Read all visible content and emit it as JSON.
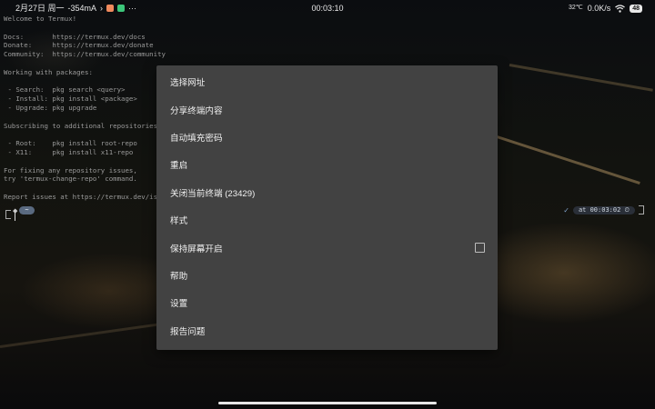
{
  "status_bar": {
    "date": "2月27日 周一",
    "current": "-354mA",
    "arrow": "›",
    "more": "···",
    "time": "00:03:10",
    "temperature": "32℃",
    "net_speed": "0.0K/s",
    "battery": "48"
  },
  "terminal": {
    "lines": [
      "Welcome to Termux!",
      "",
      "Docs:       https://termux.dev/docs",
      "Donate:     https://termux.dev/donate",
      "Community:  https://termux.dev/community",
      "",
      "Working with packages:",
      "",
      " - Search:  pkg search <query>",
      " - Install: pkg install <package>",
      " - Upgrade: pkg upgrade",
      "",
      "Subscribing to additional repositories:",
      "",
      " - Root:    pkg install root-repo",
      " - X11:     pkg install x11-repo",
      "",
      "For fixing any repository issues,",
      "try 'termux-change-repo' command.",
      "",
      "Report issues at https://termux.dev/issues"
    ],
    "prompt_left_symbol": "◆",
    "prompt_left_dir": "~",
    "prompt_right_check": "✓",
    "prompt_right_time": "at 00:03:02"
  },
  "menu": {
    "items": [
      {
        "label": "选择网址"
      },
      {
        "label": "分享终端内容"
      },
      {
        "label": "自动填充密码"
      },
      {
        "label": "重启"
      },
      {
        "label": "关闭当前终端 (23429)"
      },
      {
        "label": "样式"
      },
      {
        "label": "保持屏幕开启",
        "checkbox": true,
        "checked": false
      },
      {
        "label": "帮助"
      },
      {
        "label": "设置"
      },
      {
        "label": "报告问题"
      }
    ]
  },
  "colors": {
    "menu_background": "#424242",
    "menu_text": "#f0f0f0",
    "prompt_pill": "#5a6a80"
  }
}
